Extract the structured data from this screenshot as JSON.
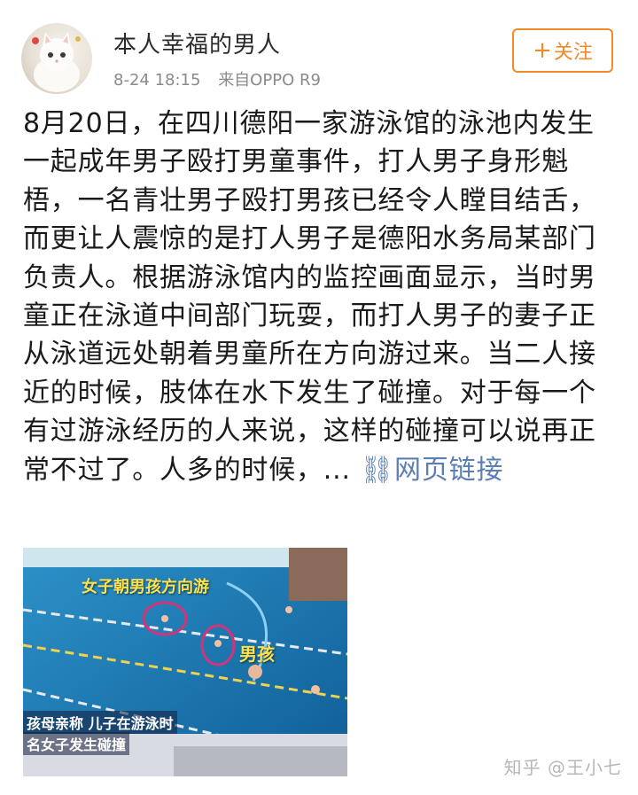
{
  "post": {
    "author": "本人幸福的男人",
    "timestamp": "8-24 18:15",
    "source": "来自OPPO R9",
    "follow_label": "关注",
    "body": "8月20日，在四川德阳一家游泳馆的泳池内发生一起成年男子殴打男童事件，打人男子身形魁梧，一名青壮男子殴打男孩已经令人瞠目结舌，而更让人震惊的是打人男子是德阳水务局某部门负责人。根据游泳馆内的监控画面显示，当时男童正在泳道中间部门玩耍，而打人男子的妻子正从泳道远处朝着男童所在方向游过来。当二人接近的时候，肢体在水下发生了碰撞。对于每一个有过游泳经历的人来说，这样的碰撞可以说再正常不过了。人多的时候，...",
    "link_text": "网页链接"
  },
  "video": {
    "caption_top": "女子朝男孩方向游",
    "caption_boy": "男孩",
    "subtitle_line1": "孩母亲称 儿子在游泳时",
    "subtitle_line2": "名女子发生碰撞"
  },
  "watermark": "知乎 @王小七",
  "colors": {
    "accent": "#f08a2a",
    "link": "#5b7fb5",
    "meta": "#8a8a8a"
  }
}
